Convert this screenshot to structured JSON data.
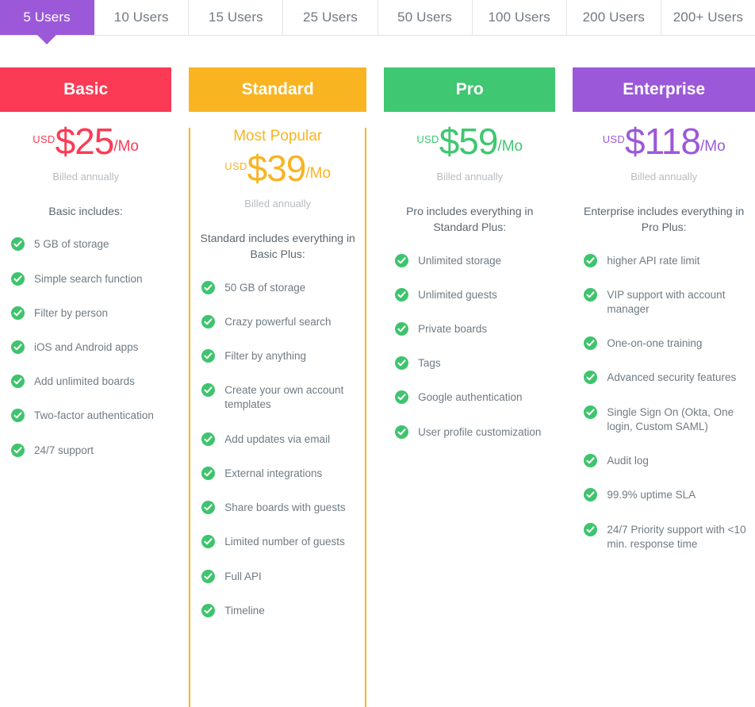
{
  "tabs": [
    {
      "label": "5 Users",
      "active": true
    },
    {
      "label": "10 Users",
      "active": false
    },
    {
      "label": "15 Users",
      "active": false
    },
    {
      "label": "25 Users",
      "active": false
    },
    {
      "label": "50 Users",
      "active": false
    },
    {
      "label": "100 Users",
      "active": false
    },
    {
      "label": "200 Users",
      "active": false
    },
    {
      "label": "200+ Users",
      "active": false
    }
  ],
  "colors": {
    "basic": "#fb3b55",
    "standard": "#f9b422",
    "pro": "#3fc771",
    "enterprise": "#9b59d9",
    "check": "#3ec46d",
    "active_tab": "#9b59d9"
  },
  "plans": [
    {
      "name": "Basic",
      "badge": "",
      "currency": "USD",
      "price": "$25",
      "period": "/Mo",
      "billing": "Billed annually",
      "includes": "Basic includes:",
      "features": [
        "5 GB of storage",
        "Simple search function",
        "Filter by person",
        "iOS and Android apps",
        "Add unlimited boards",
        "Two-factor authentication",
        "24/7 support"
      ]
    },
    {
      "name": "Standard",
      "badge": "Most Popular",
      "currency": "USD",
      "price": "$39",
      "period": "/Mo",
      "billing": "Billed annually",
      "includes": "Standard includes everything in Basic Plus:",
      "features": [
        "50 GB of storage",
        "Crazy powerful search",
        "Filter by anything",
        "Create your own account templates",
        "Add updates via email",
        "External integrations",
        "Share boards with guests",
        "Limited number of guests",
        "Full API",
        "Timeline"
      ]
    },
    {
      "name": "Pro",
      "badge": "",
      "currency": "USD",
      "price": "$59",
      "period": "/Mo",
      "billing": "Billed annually",
      "includes": "Pro includes everything in Standard Plus:",
      "features": [
        "Unlimited storage",
        "Unlimited guests",
        "Private boards",
        "Tags",
        "Google authentication",
        "User profile customization"
      ]
    },
    {
      "name": "Enterprise",
      "badge": "",
      "currency": "USD",
      "price": "$118",
      "period": "/Mo",
      "billing": "Billed annually",
      "includes": "Enterprise includes everything in Pro Plus:",
      "features": [
        "higher API rate limit",
        "VIP support with account manager",
        "One-on-one training",
        "Advanced security features",
        "Single Sign On (Okta, One login, Custom SAML)",
        "Audit log",
        "99.9% uptime SLA",
        "24/7 Priority support with <10 min. response time"
      ]
    }
  ]
}
